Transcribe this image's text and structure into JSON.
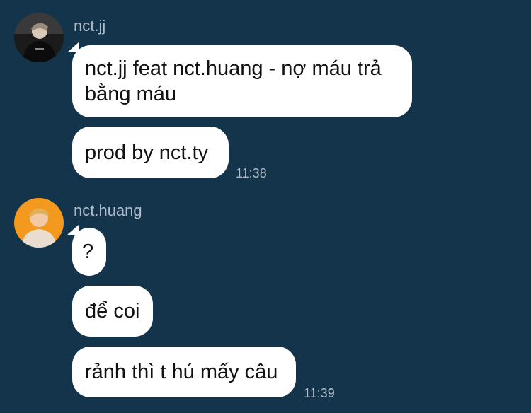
{
  "chat": {
    "messages": [
      {
        "sender": "nct.jj",
        "bubbles": [
          "nct.jj feat nct.huang - nợ máu trả bằng máu",
          "prod by nct.ty"
        ],
        "time": "11:38"
      },
      {
        "sender": "nct.huang",
        "bubbles": [
          "?",
          "để coi",
          "rảnh thì t hú mấy câu"
        ],
        "time": "11:39"
      }
    ]
  },
  "icons": {
    "avatar_jj": "user-avatar-dark",
    "avatar_huang": "user-avatar-orange"
  },
  "colors": {
    "background": "#13344a",
    "bubble": "#ffffff",
    "meta_text": "#aebdc9"
  }
}
